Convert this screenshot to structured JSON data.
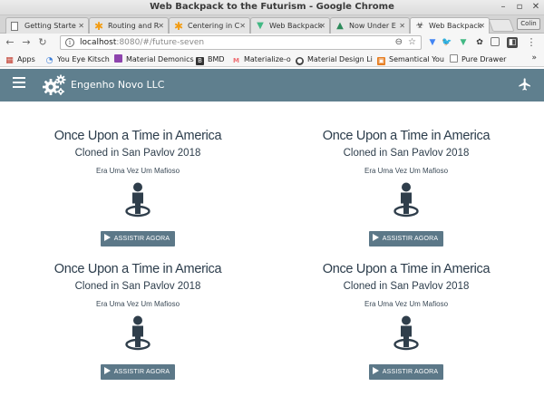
{
  "window": {
    "title": "Web Backpack to the Futurism - Google Chrome"
  },
  "tabs": [
    {
      "label": "Getting Starte",
      "icon": "doc-icon"
    },
    {
      "label": "Routing and R",
      "icon": "asterisk-icon"
    },
    {
      "label": "Centering in C",
      "icon": "asterisk-icon"
    },
    {
      "label": "Web Backpack",
      "icon": "vue-icon"
    },
    {
      "label": "Now Under E",
      "icon": "mountain-icon"
    },
    {
      "label": "Web Backpack",
      "icon": "biohazard-icon"
    }
  ],
  "profile": {
    "label": "Colin"
  },
  "omnibox": {
    "host": "localhost",
    "path": ":8080/#/future-seven"
  },
  "bookmarks": [
    {
      "label": "Apps",
      "color": "#d9534f"
    },
    {
      "label": "You Eye Kitsch",
      "color": "#3b7dd8"
    },
    {
      "label": "Material Demonics",
      "color": "#8e44ad"
    },
    {
      "label": "BMD",
      "color": "#333333"
    },
    {
      "label": "Materialize-o",
      "color": "#ee6e73"
    },
    {
      "label": "Material Design Li",
      "color": "#444444"
    },
    {
      "label": "Semantical You",
      "color": "#e67e22"
    },
    {
      "label": "Pure Drawer",
      "color": "#ffffff"
    }
  ],
  "bookmarks_more": "»",
  "appbar": {
    "brand": "Engenho Novo LLC",
    "accent": "#5f7f8e"
  },
  "cards": [
    {
      "title": "Once Upon a Time in America",
      "subtitle": "Cloned in San Pavlov 2018",
      "desc": "Era Uma Vez Um Mafioso",
      "button": "ASSISTIR AGORA"
    },
    {
      "title": "Once Upon a Time in America",
      "subtitle": "Cloned in San Pavlov 2018",
      "desc": "Era Uma Vez Um Mafioso",
      "button": "ASSISTIR AGORA"
    },
    {
      "title": "Once Upon a Time in America",
      "subtitle": "Cloned in San Pavlov 2018",
      "desc": "Era Uma Vez Um Mafioso",
      "button": "ASSISTIR AGORA"
    },
    {
      "title": "Once Upon a Time in America",
      "subtitle": "Cloned in San Pavlov 2018",
      "desc": "Era Uma Vez Um Mafioso",
      "button": "ASSISTIR AGORA"
    }
  ]
}
